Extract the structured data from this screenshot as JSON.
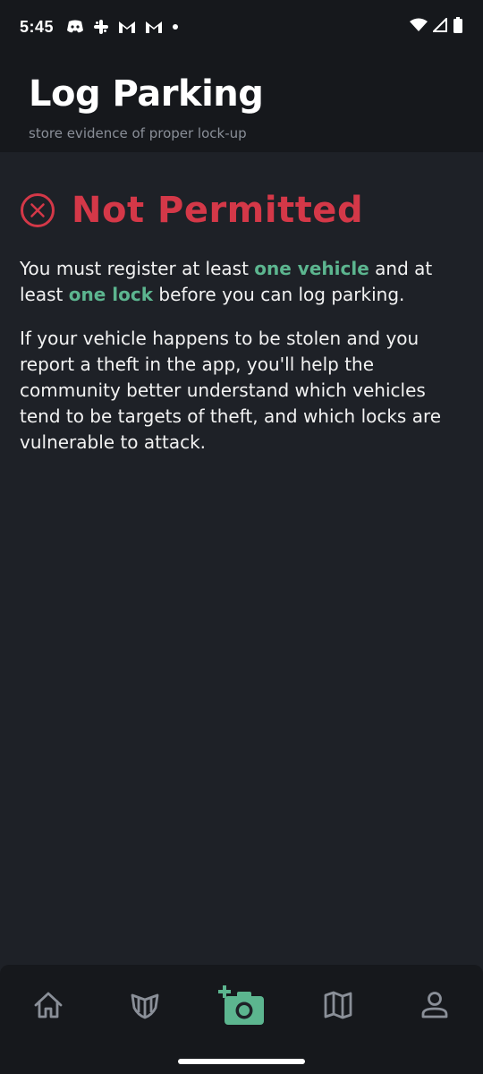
{
  "status_bar": {
    "time": "5:45",
    "left_icons": [
      "discord-icon",
      "slack-icon",
      "gmail-icon",
      "gmail-icon",
      "dot-icon"
    ],
    "right_icons": [
      "wifi-icon",
      "signal-icon",
      "battery-icon"
    ]
  },
  "header": {
    "title": "Log Parking",
    "subtitle": "store evidence of proper lock-up"
  },
  "notice": {
    "icon": "x-circle-icon",
    "title": "Not Permitted",
    "p1_a": "You must register at least ",
    "p1_link1": "one vehicle",
    "p1_b": " and at least ",
    "p1_link2": "one lock",
    "p1_c": " before you can log parking.",
    "p2": "If your vehicle happens to be stolen and you report a theft in the app, you'll help the community better understand which vehicles tend to be targets of theft, and which locks are vulnerable to attack."
  },
  "colors": {
    "background": "#1e2127",
    "header_bg": "#16181c",
    "error_red": "#d43848",
    "accent_green": "#5cb58f",
    "nav_icon": "#8a8f98"
  },
  "bottom_nav": {
    "items": [
      {
        "icon": "home-icon"
      },
      {
        "icon": "shield-icon"
      },
      {
        "icon": "add-photo-icon",
        "active": true
      },
      {
        "icon": "map-icon"
      },
      {
        "icon": "person-icon"
      }
    ]
  }
}
